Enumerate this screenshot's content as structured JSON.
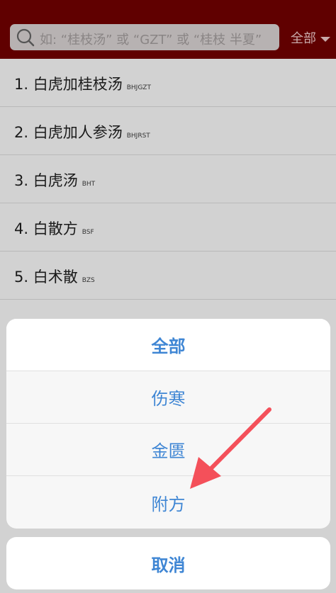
{
  "search": {
    "placeholder": "如: “桂枝汤” 或 “GZT” 或 “桂枝 半夏”",
    "filter_label": "全部"
  },
  "list": [
    {
      "name": "1. 白虎加桂枝汤",
      "code": "BHJGZT"
    },
    {
      "name": "2. 白虎加人参汤",
      "code": "BHJRST"
    },
    {
      "name": "3. 白虎汤",
      "code": "BHT"
    },
    {
      "name": "4. 白散方",
      "code": "BSF"
    },
    {
      "name": "5. 白术散",
      "code": "BZS"
    }
  ],
  "action_sheet": {
    "options": [
      "全部",
      "伤寒",
      "金匮",
      "附方"
    ],
    "cancel": "取消"
  },
  "colors": {
    "header": "#600000",
    "action_text": "#3f86d4",
    "annotation_arrow": "#f4505a"
  }
}
